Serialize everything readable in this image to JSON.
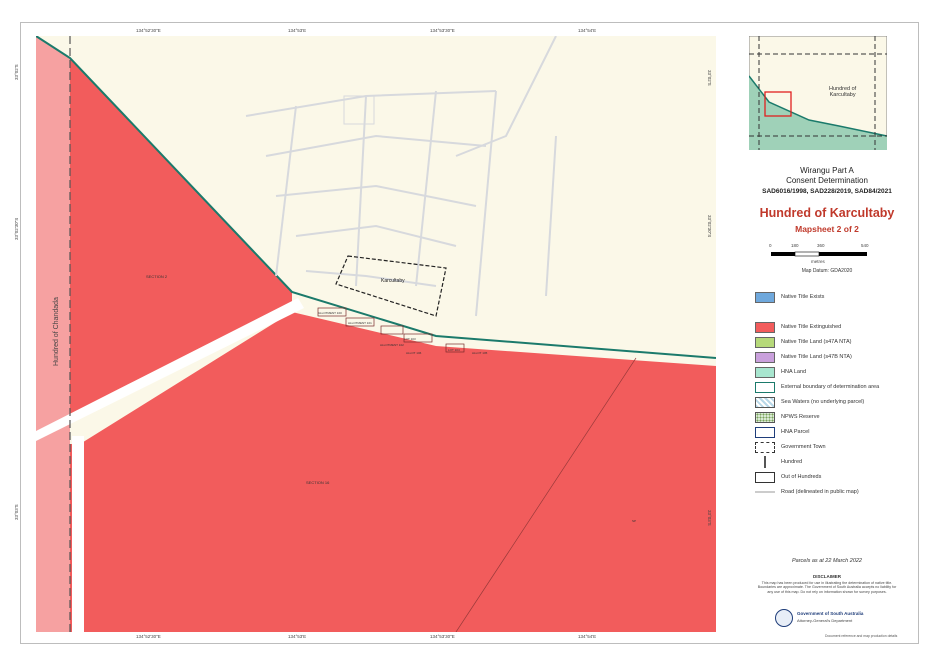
{
  "map": {
    "top_ticks": [
      "134°52'30\"E",
      "134°53'E",
      "134°53'30\"E",
      "134°54'E"
    ],
    "bottom_ticks": [
      "134°52'30\"E",
      "134°53'E",
      "134°53'30\"E",
      "134°54'E"
    ],
    "left_ticks": [
      "33°02'S",
      "33°02'30\"S",
      "33°03'S"
    ],
    "right_ticks": [
      "33°02'S",
      "33°02'30\"S",
      "33°03'S"
    ],
    "labels": {
      "hundred": "Hundred of Chandada",
      "section_a": "SECTION 2",
      "section_b": "SECTION 16",
      "town": "Karcultaby",
      "lot_1": "ALLOTMENT 100",
      "lot_2": "ALLOTMENT 101",
      "lot_3": "ALLOTMENT 102",
      "lot_4": "LOT 103",
      "lot_5": "ALLOT 106",
      "lot_6": "LOT 104",
      "lot_7": "ALLOT 105",
      "parcel_sw": "SP"
    }
  },
  "inset": {
    "label": "Hundred of\nKarcultaby"
  },
  "heading": {
    "line1": "Wirangu Part A",
    "line2": "Consent Determination",
    "line3": "SAD6016/1998, SAD228/2019, SAD84/2021",
    "title": "Hundred of Karcultaby",
    "subtitle": "Mapsheet 2 of 2"
  },
  "scalebar": {
    "ticks": [
      "0",
      "180",
      "360",
      "540"
    ],
    "unit": "metres",
    "datum": "Map Datum: GDA2020"
  },
  "legend": [
    {
      "label": "Native Title Exists",
      "color": "#6fa8dc",
      "style": "fill"
    },
    {
      "label": "Native Title Extinguished",
      "color": "#f25c5c",
      "style": "fill"
    },
    {
      "label": "Native Title Land (s47A NTA)",
      "color": "#b6d97a",
      "style": "fill"
    },
    {
      "label": "Native Title Land (s47B NTA)",
      "color": "#c9a0dc",
      "style": "fill"
    },
    {
      "label": "HNA Land",
      "color": "#a8e6cf",
      "style": "fill"
    },
    {
      "label": "External boundary of determination area",
      "color": "#1b7a6b",
      "style": "outline"
    },
    {
      "label": "Sea Waters (no underlying parcel)",
      "color": "#b8d8e8",
      "style": "hatch"
    },
    {
      "label": "NPWS Reserve",
      "color": "#d9ead3",
      "style": "dots"
    },
    {
      "label": "HNA Parcel",
      "color": "#1f3d7a",
      "style": "outline"
    },
    {
      "label": "Government Town",
      "color": "#333333",
      "style": "dash"
    },
    {
      "label": "Hundred",
      "color": "#555555",
      "style": "dash2"
    },
    {
      "label": "Out of Hundreds",
      "color": "#333333",
      "style": "outline"
    },
    {
      "label": "Road (delineated in public map)",
      "color": "#cccccc",
      "style": "line"
    }
  ],
  "footer": {
    "parcels_date": "Parcels as at 22 March 2022",
    "disclaimer_title": "DISCLAIMER",
    "disclaimer_text": "This map has been produced for use in illustrating the determination of native title. Boundaries are approximate. The Government of South Australia accepts no liability for any use of this map. Do not rely on information shown for survey purposes.",
    "org_line1": "Government of South Australia",
    "org_line2": "Attorney-General's Department",
    "ref": "Document reference and map production details"
  },
  "colors": {
    "background": "#fbf8e8",
    "extinguished": "#f25c5c",
    "extinguished_light": "#f6a1a1",
    "boundary": "#1b7a6b",
    "road": "#cfd6dc",
    "accent_title": "#c0392b",
    "inset_land": "#9fd1b8"
  }
}
